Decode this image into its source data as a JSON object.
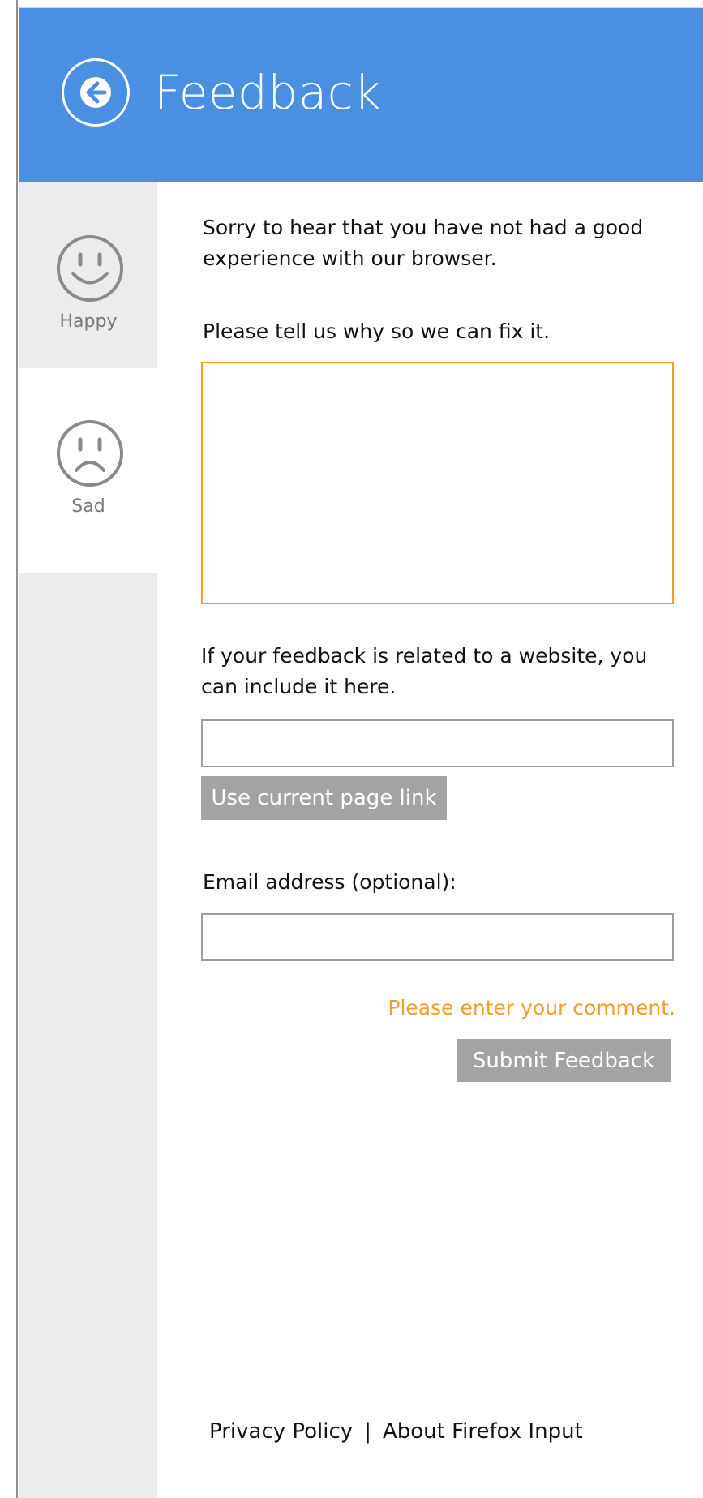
{
  "header": {
    "title": "Feedback",
    "back_icon": "arrow-left-circle-icon",
    "background_color": "#4a90e2"
  },
  "sidebar": {
    "moods": [
      {
        "label": "Happy",
        "icon": "smiley-happy-icon",
        "selected": false
      },
      {
        "label": "Sad",
        "icon": "smiley-sad-icon",
        "selected": true
      }
    ]
  },
  "form": {
    "intro": "Sorry to hear that you have not had a good experience with our browser.",
    "prompt": "Please tell us why so we can fix it.",
    "comment_value": "",
    "url_prompt": "If your feedback is related to a website, you can include it here.",
    "url_value": "",
    "use_link_label": "Use current page link",
    "email_label": "Email address (optional):",
    "email_value": "",
    "error_message": "Please enter your comment.",
    "submit_label": "Submit Feedback",
    "accent_color": "#f59d2a"
  },
  "footer": {
    "privacy": "Privacy Policy",
    "separator": "|",
    "about": "About Firefox Input"
  }
}
